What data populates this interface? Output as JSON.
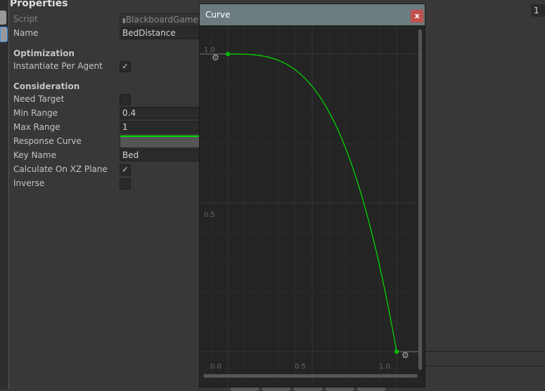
{
  "inspector": {
    "title": "Properties",
    "rows": {
      "script_label": "Script",
      "script_value": "BlackboardGame",
      "name_label": "Name",
      "name_value": "BedDistance",
      "optimization": "Optimization",
      "instantiate_label": "Instantiate Per Agent",
      "instantiate_checked": true,
      "consideration": "Consideration",
      "need_target_label": "Need Target",
      "need_target_checked": false,
      "min_range_label": "Min Range",
      "min_range_value": "0.4",
      "max_range_label": "Max Range",
      "max_range_value": "1",
      "response_curve_label": "Response Curve",
      "key_name_label": "Key Name",
      "key_name_value": "Bed",
      "xz_label": "Calculate On XZ Plane",
      "xz_checked": true,
      "inverse_label": "Inverse",
      "inverse_checked": false
    }
  },
  "check_glyph": "✓",
  "right_panel": {
    "field_value": "1"
  },
  "curve_window": {
    "title": "Curve",
    "close": "x",
    "x_ticks": [
      "0.0",
      "0.5",
      "1.0"
    ],
    "y_ticks": [
      "1.0",
      "0.5"
    ],
    "keys": [
      {
        "t": 0,
        "v": 1
      },
      {
        "t": 1,
        "v": 0
      }
    ],
    "curve_color": "#00e000"
  }
}
